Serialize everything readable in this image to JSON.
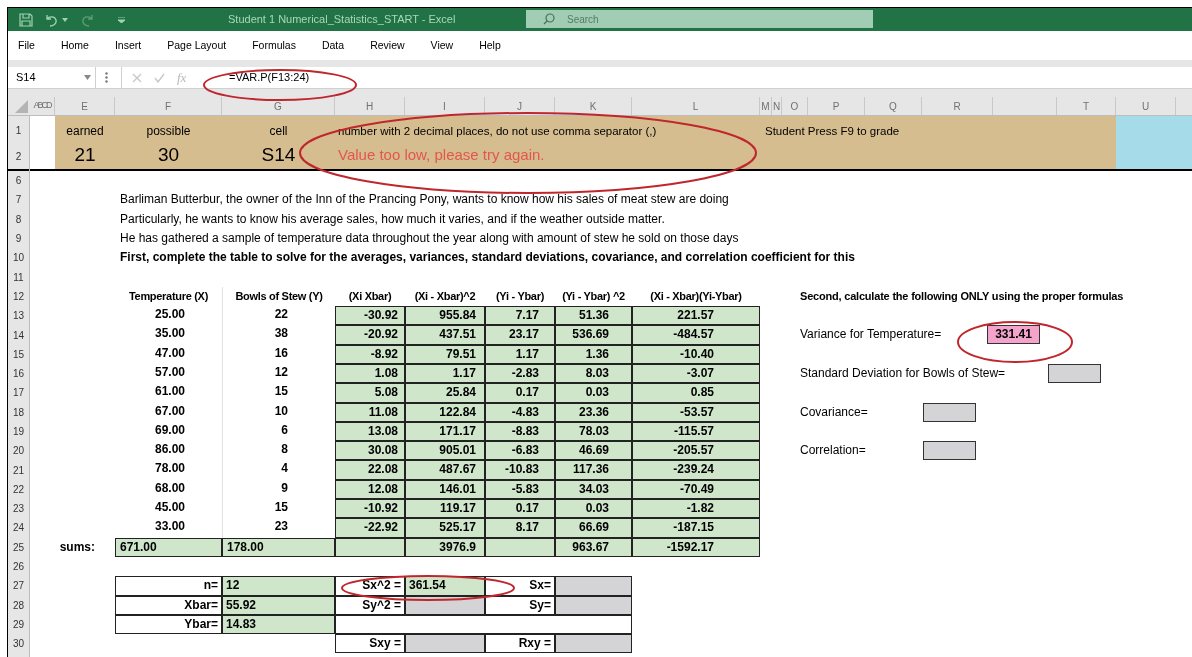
{
  "title_bar": {
    "title": "Student 1 Numerical_Statistics_START - Excel",
    "search_placeholder": "Search"
  },
  "menu": [
    "File",
    "Home",
    "Insert",
    "Page Layout",
    "Formulas",
    "Data",
    "Review",
    "View",
    "Help"
  ],
  "formula_bar": {
    "name_box": "S14",
    "function_button": "fx",
    "formula": "=VAR.P(F13:24)"
  },
  "column_headers": [
    {
      "label": "ABCD"
    },
    {
      "label": "E"
    },
    {
      "label": "F"
    },
    {
      "label": "G"
    },
    {
      "label": "H"
    },
    {
      "label": "I"
    },
    {
      "label": "J"
    },
    {
      "label": "K"
    },
    {
      "label": "L"
    },
    {
      "label": "M"
    },
    {
      "label": "N"
    },
    {
      "label": "O"
    },
    {
      "label": "P"
    },
    {
      "label": "Q"
    },
    {
      "label": "R"
    },
    {
      "label": "T"
    },
    {
      "label": "U"
    }
  ],
  "row_numbers": [
    "1",
    "2",
    "6",
    "7",
    "8",
    "9",
    "10",
    "11",
    "12",
    "13",
    "14",
    "15",
    "16",
    "17",
    "18",
    "19",
    "20",
    "21",
    "22",
    "23",
    "24",
    "25",
    "26",
    "27",
    "28",
    "29",
    "30"
  ],
  "grade_banner": {
    "earned_label": "earned",
    "earned": "21",
    "possible_label": "possible",
    "possible": "30",
    "cell_label": "cell",
    "cell": "S14",
    "instruction": "number with 2 decimal places, do not use comma separator (,)",
    "message": "Value too low, please try again.",
    "grade_hint": "Student Press F9 to grade"
  },
  "intro": [
    {
      "text": "Barliman Butterbur, the owner of the Inn of the Prancing Pony, wants to know how his sales of meat stew are doing",
      "bold": false
    },
    {
      "text": "Particularly, he wants to know his average sales, how much it varies, and if the weather outside matter.",
      "bold": false
    },
    {
      "text": "He has gathered a sample of temperature data throughout the year along with amount of stew he sold on those days",
      "bold": false
    },
    {
      "text": "First, complete the table to solve for the averages, variances, standard deviations, covariance, and correlation coefficient for this",
      "bold": true
    }
  ],
  "table": {
    "columns": [
      "Temperature (X)",
      "Bowls of Stew (Y)",
      "(Xi Xbar)",
      "(Xi - Xbar)^2",
      "(Yi - Ybar)",
      "(Yi - Ybar) ^2",
      "(Xi - Xbar)(Yi-Ybar)"
    ],
    "rows": [
      [
        "25.00",
        "22",
        "-30.92",
        "955.84",
        "7.17",
        "51.36",
        "221.57"
      ],
      [
        "35.00",
        "38",
        "-20.92",
        "437.51",
        "23.17",
        "536.69",
        "-484.57"
      ],
      [
        "47.00",
        "16",
        "-8.92",
        "79.51",
        "1.17",
        "1.36",
        "-10.40"
      ],
      [
        "57.00",
        "12",
        "1.08",
        "1.17",
        "-2.83",
        "8.03",
        "-3.07"
      ],
      [
        "61.00",
        "15",
        "5.08",
        "25.84",
        "0.17",
        "0.03",
        "0.85"
      ],
      [
        "67.00",
        "10",
        "11.08",
        "122.84",
        "-4.83",
        "23.36",
        "-53.57"
      ],
      [
        "69.00",
        "6",
        "13.08",
        "171.17",
        "-8.83",
        "78.03",
        "-115.57"
      ],
      [
        "86.00",
        "8",
        "30.08",
        "905.01",
        "-6.83",
        "46.69",
        "-205.57"
      ],
      [
        "78.00",
        "4",
        "22.08",
        "487.67",
        "-10.83",
        "117.36",
        "-239.24"
      ],
      [
        "68.00",
        "9",
        "12.08",
        "146.01",
        "-5.83",
        "34.03",
        "-70.49"
      ],
      [
        "45.00",
        "15",
        "-10.92",
        "119.17",
        "0.17",
        "0.03",
        "-1.82"
      ],
      [
        "33.00",
        "23",
        "-22.92",
        "525.17",
        "8.17",
        "66.69",
        "-187.15"
      ]
    ],
    "sums_label": "sums:",
    "sums": [
      {
        "kind": "value",
        "value": "671.00"
      },
      {
        "kind": "value",
        "value": "178.00"
      },
      {
        "kind": "empty"
      },
      {
        "kind": "value",
        "value": "3976.9"
      },
      {
        "kind": "empty"
      },
      {
        "kind": "value",
        "value": "963.67"
      },
      {
        "kind": "value",
        "value": "-1592.17"
      }
    ]
  },
  "summary": {
    "left": [
      {
        "label": "n=",
        "value": "12"
      },
      {
        "label": "Xbar=",
        "value": "55.92"
      },
      {
        "label": "Ybar=",
        "value": "14.83"
      }
    ],
    "right": [
      [
        {
          "label": "Sx^2 =",
          "value": "361.54"
        },
        {
          "label": "Sx="
        }
      ],
      [
        {
          "label": "Sy^2 ="
        },
        {
          "label": "Sy="
        }
      ],
      [
        {
          "label": "Sxy ="
        },
        {
          "label": "Rxy ="
        }
      ]
    ]
  },
  "second": {
    "heading": "Second, calculate the following ONLY using the proper formulas",
    "items": [
      {
        "label": "Variance for Temperature=",
        "value": "331.41",
        "highlighted": true
      },
      {
        "label": "Standard Deviation for Bowls of Stew=",
        "highlighted": false
      },
      {
        "label": "Covariance=",
        "highlighted": false
      },
      {
        "label": "Correlation=",
        "highlighted": false
      }
    ]
  }
}
